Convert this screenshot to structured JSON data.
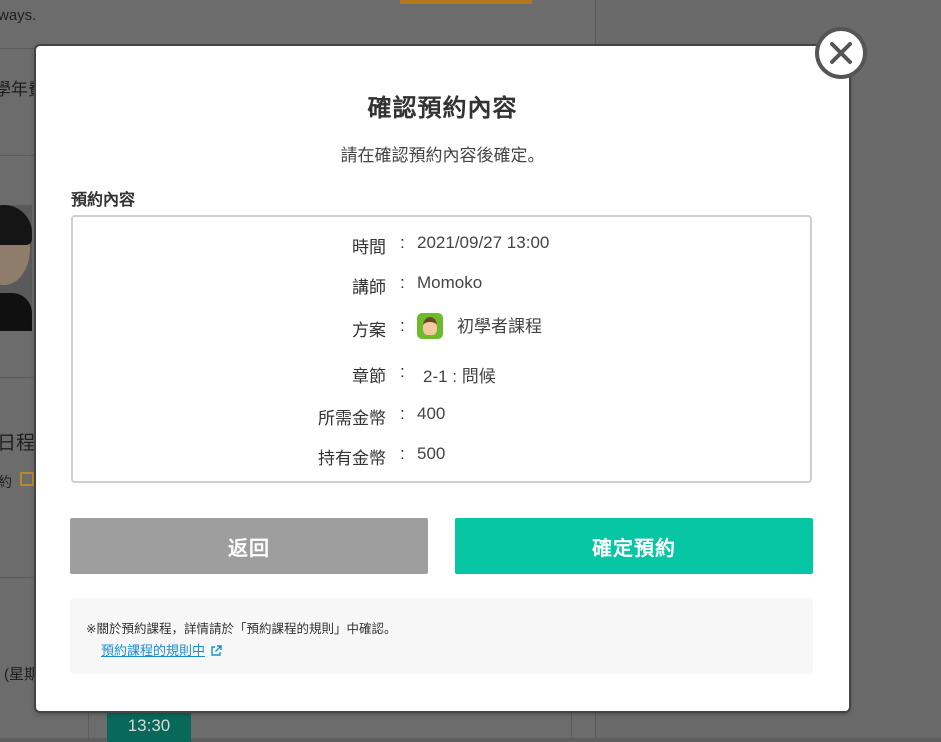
{
  "background": {
    "fragment_ways": "ways.",
    "fragment_year": "學年費",
    "fragment_schedule": "日程",
    "fragment_reserve": "約",
    "fragment_weekday": "(星期",
    "time_slot": "13:30"
  },
  "modal": {
    "title": "確認預約內容",
    "subtitle": "請在確認預約內容後確定。",
    "section_label": "預約內容",
    "details": [
      {
        "label": "時間",
        "value": "2021/09/27 13:00"
      },
      {
        "label": "講師",
        "value": "Momoko"
      },
      {
        "label": "方案",
        "value": "初學者課程",
        "icon": "beginner-course-icon"
      },
      {
        "label": "章節",
        "value": "2-1 : 問候"
      },
      {
        "label": "所需金幣",
        "value": "400"
      },
      {
        "label": "持有金幣",
        "value": "500"
      }
    ],
    "colon": ":",
    "back_label": "返回",
    "confirm_label": "確定預約",
    "notice_text": "※關於預約課程，詳情請於「預約課程的規則」中確認。",
    "notice_link": "預約課程的規則中"
  },
  "colors": {
    "confirm": "#06c6a4",
    "back": "#9e9e9e",
    "link": "#1a8fcf"
  }
}
